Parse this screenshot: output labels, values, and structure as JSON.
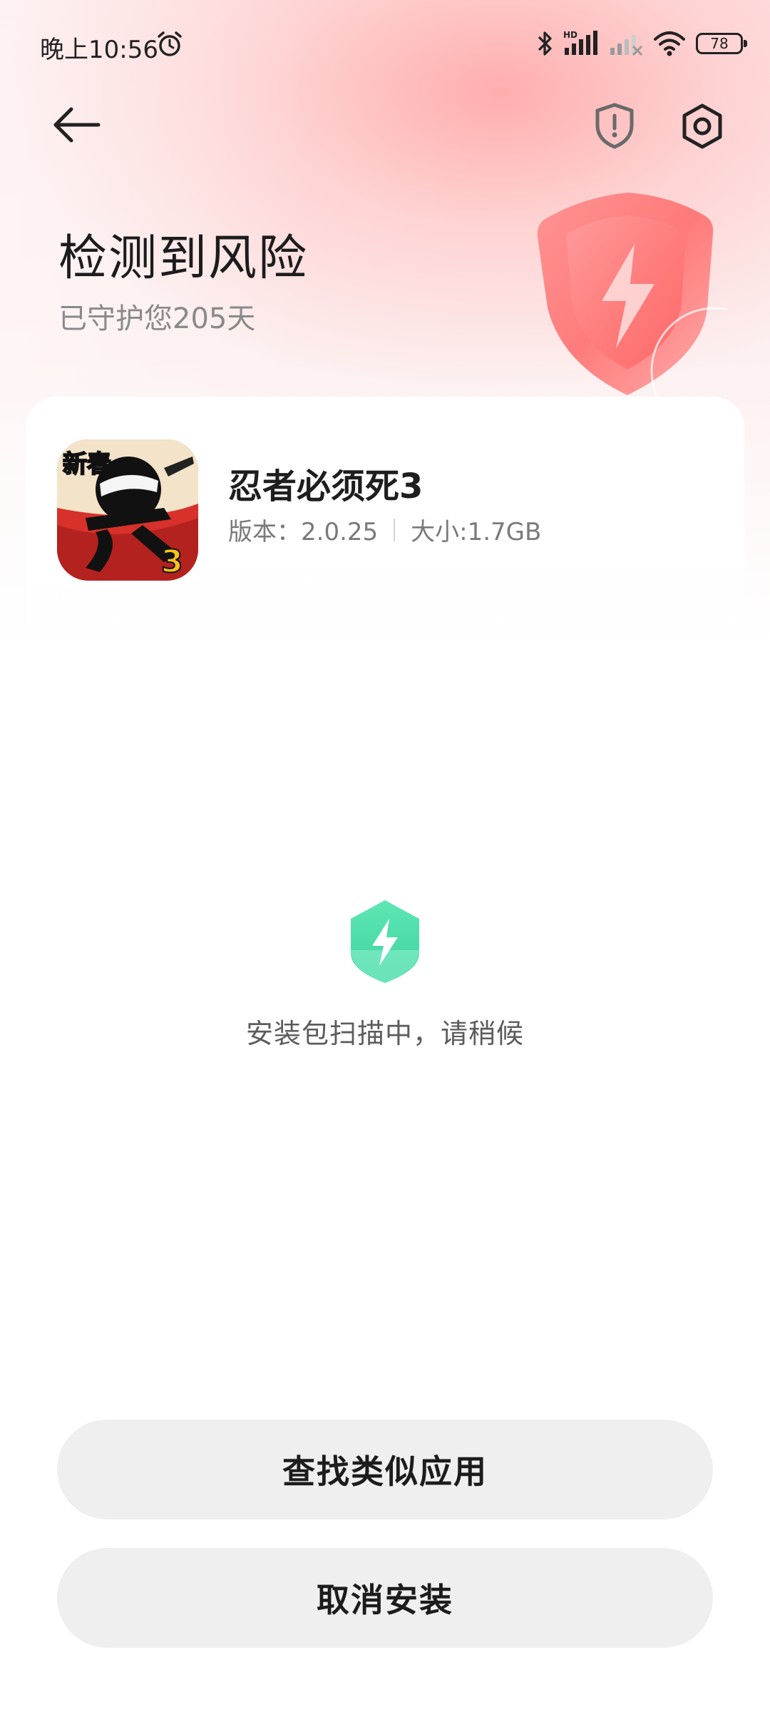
{
  "status_bar": {
    "time": "晚上10:56",
    "battery_level": "78",
    "icons": [
      "alarm-icon",
      "bluetooth-icon",
      "signal-hd-icon",
      "signal-weak-icon",
      "wifi-icon",
      "battery-icon"
    ]
  },
  "toolbar": {
    "back_icon": "arrow-left-icon",
    "shield_icon": "shield-alert-icon",
    "settings_icon": "hexagon-settings-icon"
  },
  "header": {
    "title": "检测到风险",
    "subtitle": "已守护您205天"
  },
  "app": {
    "name": "忍者必须死3",
    "version": "版本：2.0.25",
    "size": "大小:1.7GB",
    "icon_badge_top": "新春",
    "icon_badge_number": "3"
  },
  "scan": {
    "message": "安装包扫描中，请稍候"
  },
  "actions": {
    "find_similar": "查找类似应用",
    "cancel_install": "取消安装"
  },
  "colors": {
    "risk_red": "#ff6b6b",
    "scan_green": "#3fd9a6",
    "button_bg": "#efefef"
  }
}
